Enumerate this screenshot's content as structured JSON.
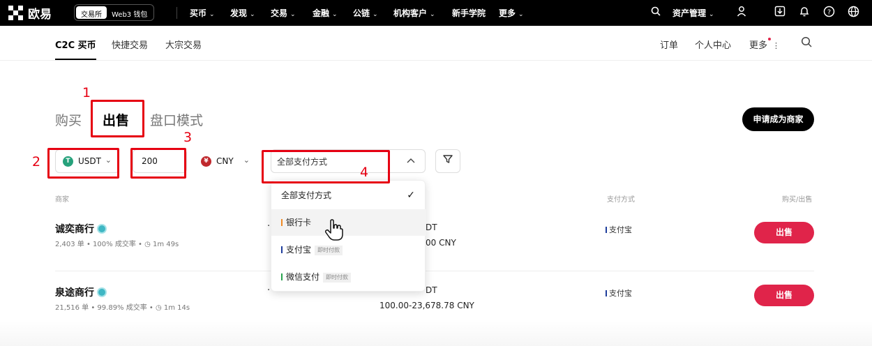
{
  "topnav": {
    "brand": "欧易",
    "segment": {
      "active": "交易所",
      "inactive": "Web3 钱包"
    },
    "items": [
      "买币",
      "发现",
      "交易",
      "金融",
      "公链",
      "机构客户",
      "新手学院",
      "更多"
    ],
    "asset_management": "资产管理"
  },
  "subnav": {
    "items": [
      "C2C 买币",
      "快捷交易",
      "大宗交易"
    ],
    "right": [
      "订单",
      "个人中心",
      "更多"
    ]
  },
  "tabs": [
    "购买",
    "出售",
    "盘口模式"
  ],
  "apply_merchant": "申请成为商家",
  "filters": {
    "coin": "USDT",
    "amount": "200",
    "fiat": "CNY",
    "payment": "全部支付方式"
  },
  "table": {
    "headers": [
      "商家",
      "支付方式",
      "购买/出售"
    ],
    "rows": [
      {
        "merchant": "诚奕商行",
        "stats": "2,403 单  •  100% 成交率  •  ◷ 1m 49s",
        "limit_line1": "DT",
        "limit_line2": "00 CNY",
        "payment": "支付宝",
        "action": "出售"
      },
      {
        "merchant": "泉途商行",
        "stats": "21,516 单  •  99.89% 成交率  •  ◷ 1m 14s",
        "limit_line1": "DT",
        "limit_line2": "100.00-23,678.78 CNY",
        "payment": "支付宝",
        "action": "出售"
      }
    ]
  },
  "dropdown": {
    "items": [
      {
        "label": "全部支付方式",
        "tag": "",
        "color": ""
      },
      {
        "label": "银行卡",
        "tag": "",
        "color": "#f08a24"
      },
      {
        "label": "支付宝",
        "tag": "即时付款",
        "color": "#1d3c9b"
      },
      {
        "label": "微信支付",
        "tag": "即时付款",
        "color": "#2aa44f"
      }
    ]
  },
  "annotations": [
    "1",
    "2",
    "3",
    "4"
  ],
  "colors": {
    "sell": "#e0244a",
    "annotation": "#e60012",
    "usdt": "#26a17b",
    "cny": "#c0282d"
  }
}
